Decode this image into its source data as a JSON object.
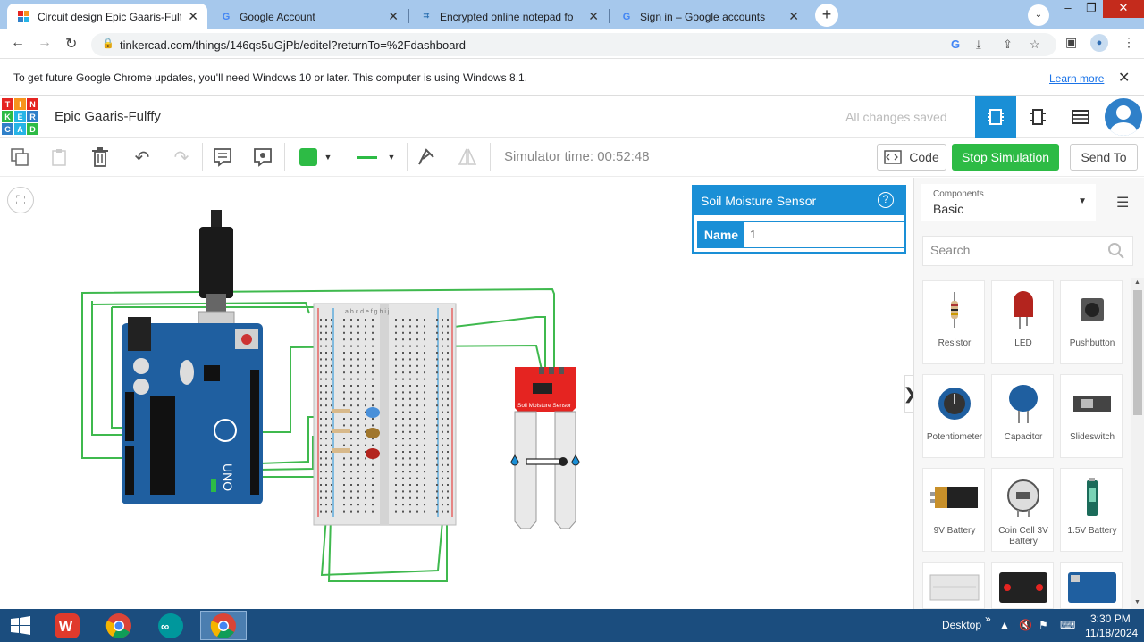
{
  "browser": {
    "tabs": [
      {
        "title": "Circuit design Epic Gaaris-Fulffy -",
        "favicon": "tinkercad-icon",
        "active": true
      },
      {
        "title": "Google Account",
        "favicon": "google-icon",
        "active": false
      },
      {
        "title": "Encrypted online notepad for sec",
        "favicon": "notepad-icon",
        "active": false
      },
      {
        "title": "Sign in – Google accounts",
        "favicon": "google-icon",
        "active": false
      }
    ],
    "url": "tinkercad.com/things/146qs5uGjPb/editel?returnTo=%2Fdashboard",
    "infobar": {
      "message": "To get future Google Chrome updates, you'll need Windows 10 or later. This computer is using Windows 8.1.",
      "link": "Learn more"
    }
  },
  "tinkercad": {
    "logo": [
      "T",
      "I",
      "N",
      "K",
      "E",
      "R",
      "C",
      "A",
      "D"
    ],
    "design_title": "Epic Gaaris-Fulffy",
    "save_status": "All changes saved",
    "simulator_time": "Simulator time: 00:52:48",
    "buttons": {
      "code": "Code",
      "stop": "Stop Simulation",
      "send": "Send To"
    },
    "inspector": {
      "title": "Soil Moisture Sensor",
      "name_label": "Name",
      "name_value": "1"
    },
    "components_label": "Components",
    "components_value": "Basic",
    "search_placeholder": "Search",
    "components": [
      {
        "name": "Resistor"
      },
      {
        "name": "LED"
      },
      {
        "name": "Pushbutton"
      },
      {
        "name": "Potentiometer"
      },
      {
        "name": "Capacitor"
      },
      {
        "name": "Slideswitch"
      },
      {
        "name": "9V Battery"
      },
      {
        "name": "Coin Cell 3V Battery"
      },
      {
        "name": "1.5V Battery"
      }
    ],
    "sensor_label": "Soil Moisture Sensor",
    "breadboard_cols": "a b c d e   f g h i j",
    "arduino_label": "UNO",
    "colors": {
      "accent": "#1a8fd6",
      "stop": "#2dbb45",
      "wire": "#3fb94e",
      "arduino": "#1f5fa0",
      "sensor": "#e52421"
    }
  },
  "taskbar": {
    "desktop": "Desktop",
    "time": "3:30 PM",
    "date": "11/18/2024"
  }
}
